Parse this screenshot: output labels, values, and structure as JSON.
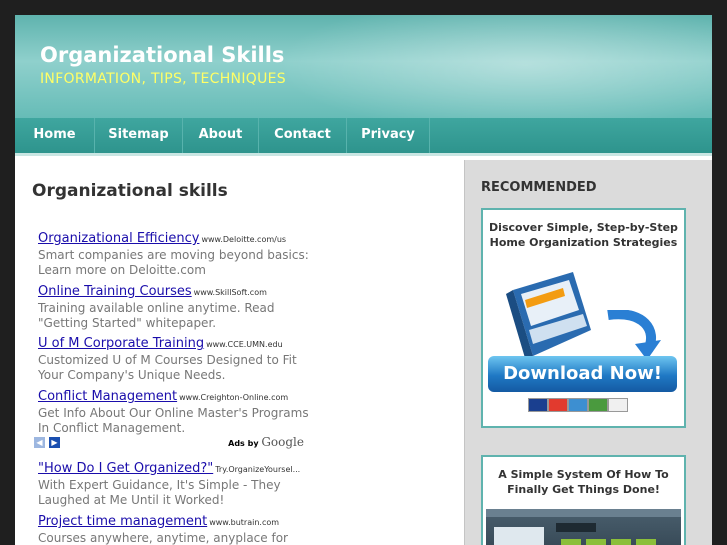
{
  "header": {
    "title": "Organizational Skills",
    "tagline": "INFORMATION, TIPS, TECHNIQUES"
  },
  "nav": {
    "items": [
      "Home",
      "Sitemap",
      "About",
      "Contact",
      "Privacy"
    ]
  },
  "main": {
    "title": "Organizational skills",
    "ads": [
      {
        "title": "Organizational Efficiency",
        "url": "www.Deloitte.com/us",
        "desc": "Smart companies are moving beyond basics: Learn more on Deloitte.com"
      },
      {
        "title": "Online Training Courses",
        "url": "www.SkillSoft.com",
        "desc": "Training available online anytime. Read \"Getting Started\" whitepaper."
      },
      {
        "title": "U of M Corporate Training",
        "url": "www.CCE.UMN.edu",
        "desc": "Customized U of M Courses Designed to Fit Your Company's Unique Needs."
      },
      {
        "title": "Conflict Management",
        "url": "www.Creighton-Online.com",
        "desc": "Get Info About Our Online Master's Programs In Conflict Management."
      },
      {
        "title": "\"How Do I Get Organized?\"",
        "url": "Try.OrganizeYoursel...",
        "desc": "With Expert Guidance, It's Simple - They Laughed at Me Until it Worked!"
      },
      {
        "title": "Project time management",
        "url": "www.butrain.com",
        "desc": "Courses anywhere, anytime, anyplace for busy professionals like you."
      }
    ],
    "ads_by": "Ads by",
    "google": "Google",
    "prev_arrow": "◀",
    "next_arrow": "▶"
  },
  "sidebar": {
    "heading": "RECOMMENDED",
    "box1": {
      "title_line1": "Discover Simple, Step-by-Step",
      "title_line2": "Home Organization Strategies",
      "download": "Download Now!"
    },
    "box2": {
      "title_line1": "A Simple System Of How To",
      "title_line2": "Finally Get Things Done!"
    }
  },
  "colors": {
    "accent": "#5fb3ae",
    "link": "#1a0dab",
    "tagline": "#ffff66"
  }
}
